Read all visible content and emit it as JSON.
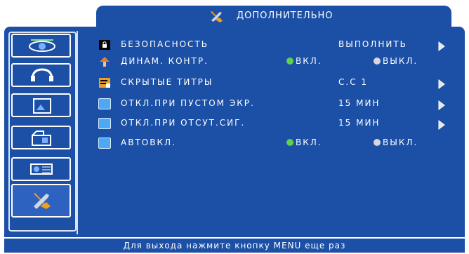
{
  "header": {
    "title": "ДОПОЛНИТЕЛЬНО",
    "icon": "tools-icon"
  },
  "sidebar": {
    "items": [
      {
        "icon": "eye-icon"
      },
      {
        "icon": "audio-icon"
      },
      {
        "icon": "picture-icon"
      },
      {
        "icon": "settings-box-icon"
      },
      {
        "icon": "projector-icon"
      },
      {
        "icon": "tools-icon",
        "selected": true
      }
    ]
  },
  "menu": {
    "security": {
      "label": "БЕЗОПАСНОСТЬ",
      "value": "ВЫПОЛНИТЬ"
    },
    "dynamic_contrast": {
      "label": "ДИНАМ. КОНТР.",
      "on": "ВКЛ.",
      "off": "ВЫКЛ."
    },
    "captions": {
      "label": "СКРЫТЫЕ ТИТРЫ",
      "value": "С.С 1"
    },
    "blank_off": {
      "label": "ОТКЛ.ПРИ ПУСТОМ ЭКР.",
      "value": "15 МИН"
    },
    "nosignal_off": {
      "label": "ОТКЛ.ПРИ ОТСУТ.СИГ.",
      "value": "15 МИН"
    },
    "auto_on": {
      "label": "АВТОВКЛ.",
      "on": "ВКЛ.",
      "off": "ВЫКЛ."
    }
  },
  "footer": {
    "hint": "Для выхода нажмите кнопку MENU еще раз"
  },
  "colors": {
    "background": "#1c50a6",
    "accent": "#4fa8f5",
    "on_dot": "#5fd14a",
    "off_dot": "#d8d8d8"
  }
}
